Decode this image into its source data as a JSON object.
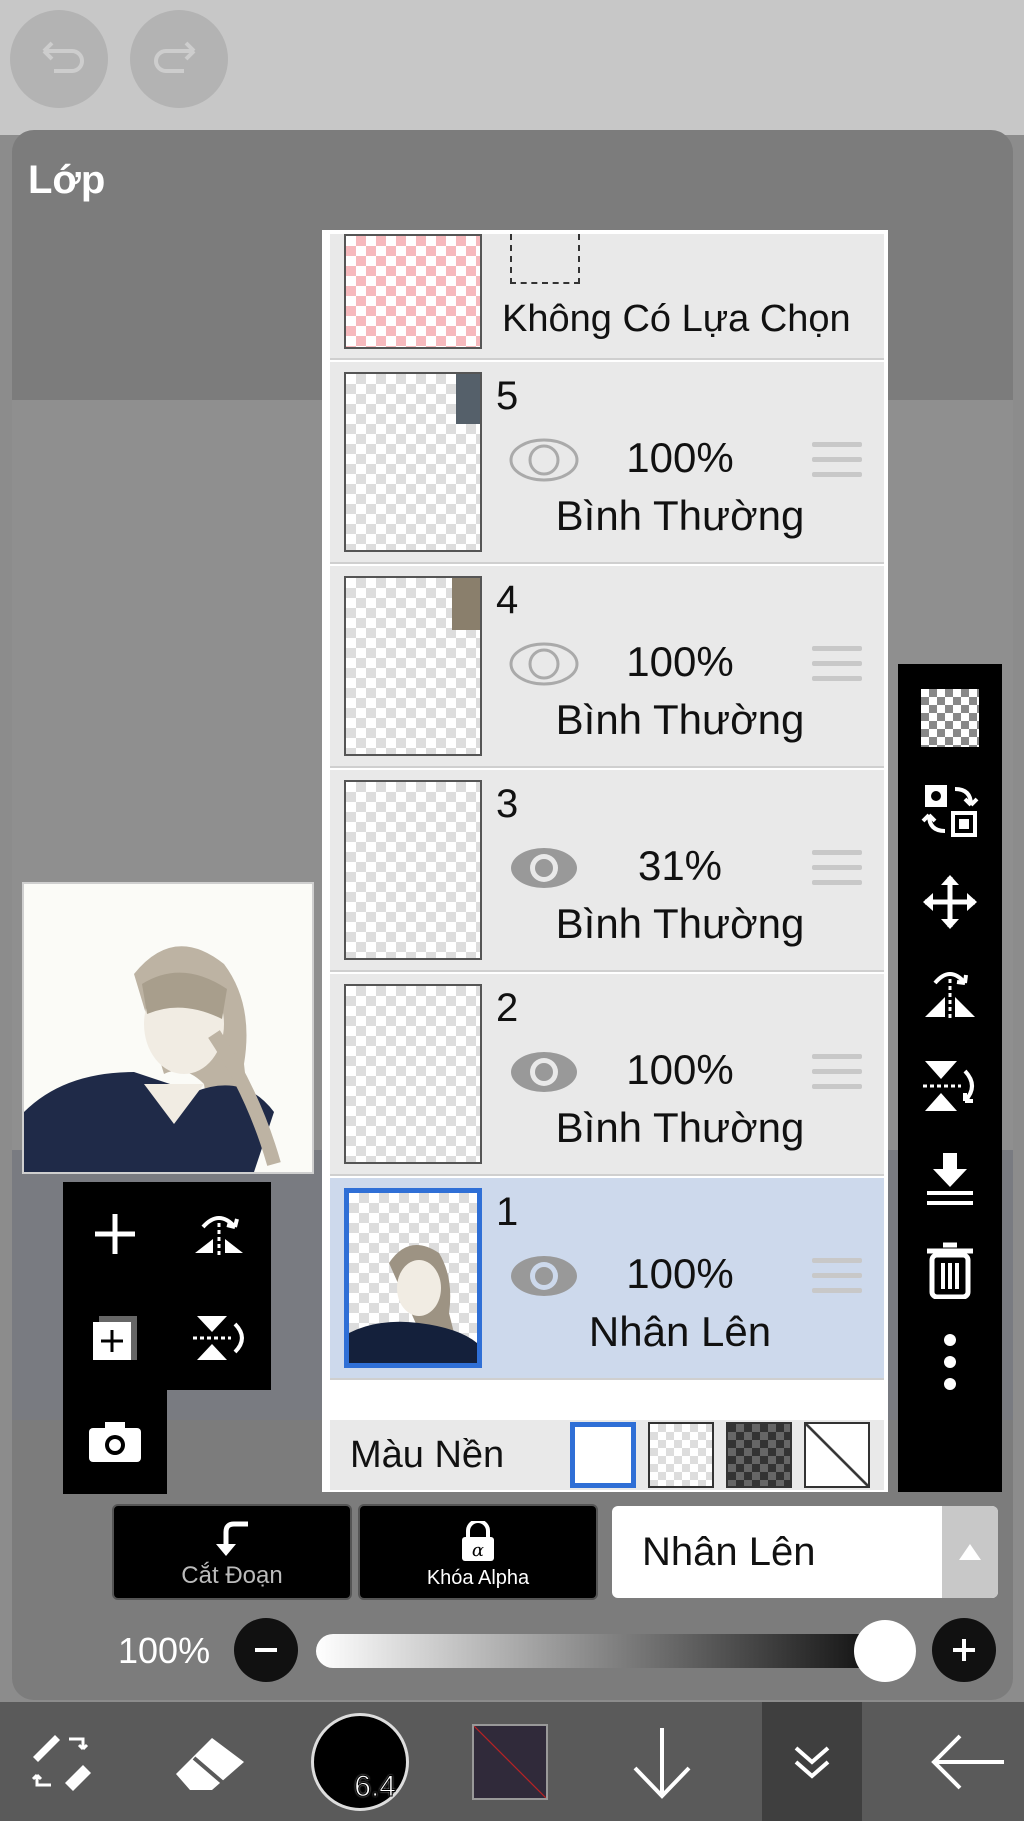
{
  "panel": {
    "title": "Lớp"
  },
  "selection_row": {
    "label": "Không Có Lựa Chọn"
  },
  "layers": [
    {
      "number": "5",
      "opacity": "100%",
      "blend": "Bình Thường",
      "visible": true,
      "selected": false
    },
    {
      "number": "4",
      "opacity": "100%",
      "blend": "Bình Thường",
      "visible": true,
      "selected": false
    },
    {
      "number": "3",
      "opacity": "31%",
      "blend": "Bình Thường",
      "visible": true,
      "selected": false
    },
    {
      "number": "2",
      "opacity": "100%",
      "blend": "Bình Thường",
      "visible": true,
      "selected": false
    },
    {
      "number": "1",
      "opacity": "100%",
      "blend": "Nhân Lên",
      "visible": true,
      "selected": true
    }
  ],
  "background_row": {
    "label": "Màu Nền"
  },
  "bottom_controls": {
    "clipping_label": "Cắt Đoạn",
    "alpha_lock_label": "Khóa Alpha",
    "blend_mode": "Nhân Lên",
    "opacity_label": "100%",
    "opacity_value": 1.0
  },
  "brush_size": "6.4",
  "colors": {
    "accent": "#2f6fd6",
    "selected_row": "#cdd9ec",
    "toolbar": "#000000"
  }
}
